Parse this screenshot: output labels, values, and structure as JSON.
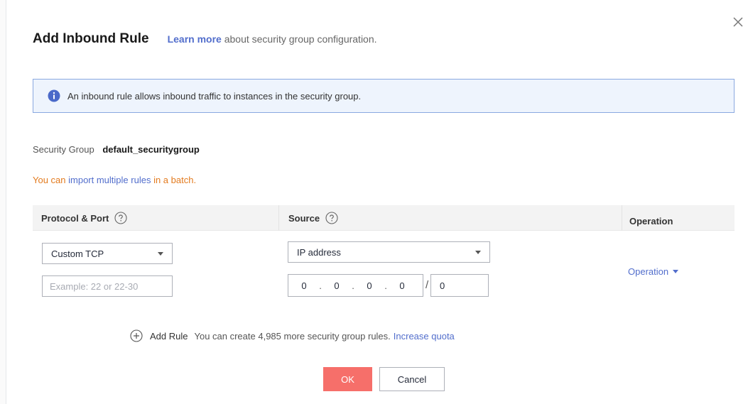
{
  "dialog": {
    "title": "Add Inbound Rule",
    "learn_more_link": "Learn more",
    "learn_more_text": "about security group configuration.",
    "close_label": "close"
  },
  "info_banner": {
    "text": "An inbound rule allows inbound traffic to instances in the security group.",
    "icon": "info-icon"
  },
  "security_group": {
    "label": "Security Group",
    "value": "default_securitygroup"
  },
  "batch_hint": {
    "prefix": "You can ",
    "link": "import multiple rules",
    "suffix": " in a batch."
  },
  "table": {
    "columns": [
      {
        "label": "Protocol & Port",
        "help": true
      },
      {
        "label": "Source",
        "help": true
      },
      {
        "label": "Operation",
        "help": false
      }
    ],
    "rows": [
      {
        "protocol": "Custom TCP",
        "port_placeholder": "Example: 22 or 22-30",
        "source_type": "IP address",
        "ip_octets": [
          "0",
          "0",
          "0",
          "0"
        ],
        "ip_mask": "0",
        "operation": "Operation"
      }
    ]
  },
  "add_rule": {
    "label": "Add Rule",
    "quota_text": "You can create 4,985 more security group rules.",
    "quota_link": "Increase quota"
  },
  "footer": {
    "ok_label": "OK",
    "cancel_label": "Cancel"
  },
  "colors": {
    "accent_link": "#526ecc",
    "primary_button": "#f66f6a",
    "info_background": "#eef4fd",
    "warning_text": "#e37b1f"
  }
}
